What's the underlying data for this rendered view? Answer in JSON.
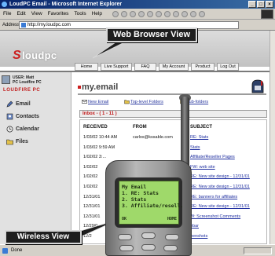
{
  "window": {
    "title": "LoudPC Email - Microsoft Internet Explorer",
    "controls": [
      "_",
      "□",
      "×"
    ]
  },
  "menubar": [
    "File",
    "Edit",
    "View",
    "Favorites",
    "Tools",
    "Help"
  ],
  "address": {
    "label": "Address",
    "url": "http://my.loudpc.com"
  },
  "site": {
    "logo": "loudpc",
    "nav": [
      "Home",
      "Live Support",
      "FAQ",
      "My Account",
      "Product",
      "Log Out"
    ]
  },
  "sidebar": {
    "user_line1": "USER: Matt",
    "user_line2": "PC  Loudfire PC",
    "section_title": "LOUDFIRE PC",
    "items": [
      "Email",
      "Contacts",
      "Calendar",
      "Files"
    ]
  },
  "main": {
    "title": "my.email",
    "actions": [
      "New Email",
      "Top-level Folders",
      "Sub-folders"
    ],
    "inbox_label": "Inbox - ( 1 - 11 )",
    "columns": [
      "RECEIVED",
      "FROM",
      "SUBJECT"
    ],
    "rows": [
      {
        "received": "1/03/02 10:44 AM",
        "from": "carlos@kssable.com",
        "subject": "RE: Stats"
      },
      {
        "received": "1/03/02 9:59 AM",
        "from": "",
        "subject": "Stats"
      },
      {
        "received": "1/02/02 3:...",
        "from": "",
        "subject": "Affiliate/Reseller Pages"
      },
      {
        "received": "1/02/02",
        "from": "",
        "subject": "FW: web site"
      },
      {
        "received": "1/02/02",
        "from": "",
        "subject": "RE: New site design - 12/31/01"
      },
      {
        "received": "1/02/02",
        "from": "",
        "subject": "RE: New site design - 12/31/01"
      },
      {
        "received": "12/31/01",
        "from": "",
        "subject": "RE: banners for affiliates"
      },
      {
        "received": "12/31/01",
        "from": "",
        "subject": "RE: New site design - 12/31/01"
      },
      {
        "received": "12/31/01",
        "from": "",
        "subject": "W: Screenshot Comments"
      },
      {
        "received": "12/29/0",
        "from": "",
        "subject": "ebar"
      },
      {
        "received": "12/2",
        "from": "",
        "subject": "eenshots"
      }
    ]
  },
  "phone": {
    "screen_title": "My Email",
    "lines": [
      "1. RE: Stats",
      "2. Stats",
      "3. Affiliate/resell."
    ],
    "softkey_left": "OK",
    "softkey_right": "HOME"
  },
  "callouts": {
    "web": "Web Browser View",
    "wireless": "Wireless View"
  },
  "status": {
    "text": "Done"
  }
}
